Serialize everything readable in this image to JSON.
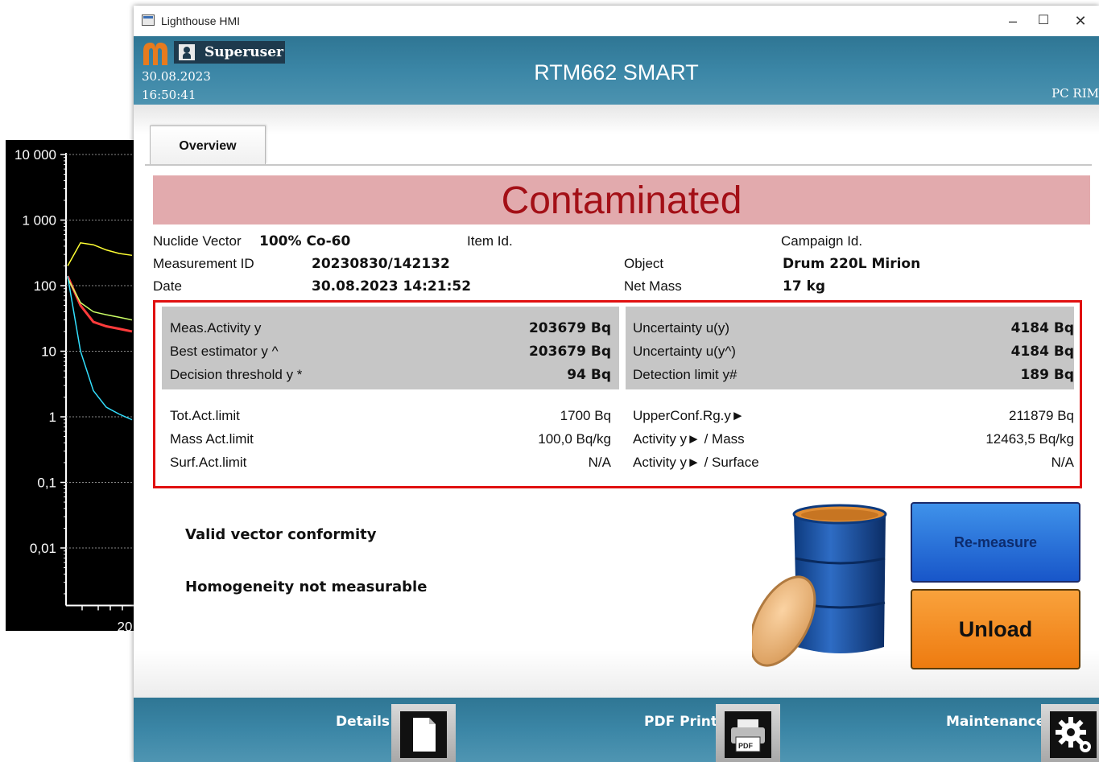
{
  "window": {
    "title": "Lighthouse HMI",
    "minimize": "–",
    "maximize": "☐",
    "close": "✕"
  },
  "header": {
    "user": "Superuser",
    "date": "30.08.2023",
    "time": "16:50:41",
    "device": "RTM662 SMART",
    "pc": "PC RIM",
    "logo_color": "#e77b1e"
  },
  "tabs": [
    {
      "label": "Overview",
      "active": true
    }
  ],
  "status": {
    "text": "Contaminated",
    "bg_color": "#e2aaad",
    "text_color": "#a30f16"
  },
  "info": {
    "nuclide_vector_label": "Nuclide Vector",
    "nuclide_vector_value": "100% Co-60",
    "item_id_label": "Item Id.",
    "campaign_id_label": "Campaign Id.",
    "measurement_id_label": "Measurement ID",
    "measurement_id_value": "20230830/142132",
    "object_label": "Object",
    "object_value": "Drum 220L Mirion",
    "date_label": "Date",
    "date_value": "30.08.2023 14:21:52",
    "net_mass_label": "Net Mass",
    "net_mass_value": "17 kg"
  },
  "results": {
    "meas_activity_label": "Meas.Activity y",
    "meas_activity_value": "203679 Bq",
    "best_estimator_label": "Best estimator y ^",
    "best_estimator_value": "203679 Bq",
    "decision_threshold_label": "Decision threshold y *",
    "decision_threshold_value": "94 Bq",
    "uncertainty_y_label": "Uncertainty u(y)",
    "uncertainty_y_value": "4184 Bq",
    "uncertainty_yhat_label": "Uncertainty u(y^)",
    "uncertainty_yhat_value": "4184 Bq",
    "detection_limit_label": "Detection limit y#",
    "detection_limit_value": "189 Bq",
    "tot_act_limit_label": "Tot.Act.limit",
    "tot_act_limit_value": "1700 Bq",
    "mass_act_limit_label": "Mass Act.limit",
    "mass_act_limit_value": "100,0 Bq/kg",
    "surf_act_limit_label": "Surf.Act.limit",
    "surf_act_limit_value": "N/A",
    "upper_conf_label": "UpperConf.Rg.y►",
    "upper_conf_value": "211879 Bq",
    "activity_mass_label": "Activity y► / Mass",
    "activity_mass_value": "12463,5 Bq/kg",
    "activity_surface_label": "Activity y► / Surface",
    "activity_surface_value": "N/A"
  },
  "messages": {
    "vector": "Valid vector conformity",
    "homogeneity": "Homogeneity not measurable"
  },
  "buttons": {
    "remeasure": "Re-measure",
    "unload": "Unload"
  },
  "footer": {
    "details": "Details",
    "pdf_print": "PDF Print",
    "maintenance": "Maintenance",
    "pdf_badge": "PDF"
  },
  "chart_data": {
    "type": "line",
    "yscale": "log",
    "ylim": [
      0.001,
      10000
    ],
    "yticks": [
      {
        "label": "10 000",
        "value": 10000
      },
      {
        "label": "1 000",
        "value": 1000
      },
      {
        "label": "100",
        "value": 100
      },
      {
        "label": "10",
        "value": 10
      },
      {
        "label": "1",
        "value": 1
      },
      {
        "label": "0,1",
        "value": 0.1
      },
      {
        "label": "0,01",
        "value": 0.01
      }
    ],
    "xtick_label": "20",
    "series": [
      {
        "color": "#ffff33",
        "x": [
          0,
          1,
          2,
          3,
          4,
          5
        ],
        "values": [
          200,
          450,
          420,
          350,
          310,
          290
        ]
      },
      {
        "color": "#ff3b3b",
        "x": [
          0,
          1,
          2,
          3,
          4,
          5
        ],
        "values": [
          140,
          50,
          28,
          24,
          22,
          20
        ]
      },
      {
        "color": "#ccff66",
        "x": [
          0,
          1,
          2,
          3,
          4,
          5
        ],
        "values": [
          130,
          55,
          40,
          36,
          33,
          30
        ]
      },
      {
        "color": "#33e0ff",
        "x": [
          0,
          1,
          2,
          3,
          4,
          5
        ],
        "values": [
          140,
          10,
          2.5,
          1.4,
          1.1,
          0.9
        ]
      }
    ]
  }
}
